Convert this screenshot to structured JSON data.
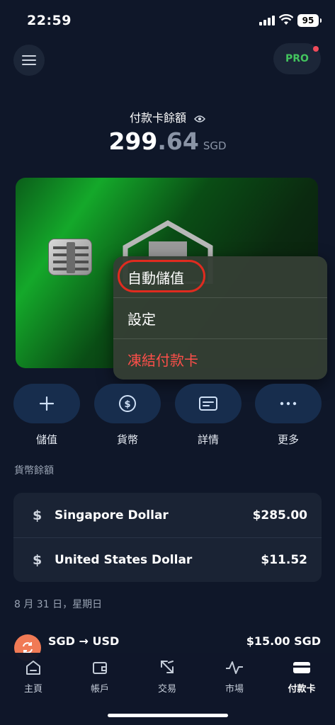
{
  "status_bar": {
    "time": "22:59",
    "battery": "95"
  },
  "header": {
    "pro_label": "PRO"
  },
  "balance": {
    "label": "付款卡餘額",
    "integer": "299",
    "decimal": ".64",
    "currency": "SGD"
  },
  "context_menu": {
    "items": [
      {
        "label": "自動儲值",
        "highlighted": true
      },
      {
        "label": "設定"
      },
      {
        "label": "凍結付款卡",
        "destructive": true
      }
    ]
  },
  "actions": [
    {
      "label": "儲值",
      "icon": "plus-icon"
    },
    {
      "label": "貨幣",
      "icon": "dollar-circle-icon"
    },
    {
      "label": "詳情",
      "icon": "card-details-icon"
    },
    {
      "label": "更多",
      "icon": "more-icon"
    }
  ],
  "currency_section": {
    "title": "貨幣餘額",
    "rows": [
      {
        "symbol": "$",
        "name": "Singapore Dollar",
        "amount": "$285.00"
      },
      {
        "symbol": "$",
        "name": "United States Dollar",
        "amount": "$11.52"
      }
    ]
  },
  "transactions": {
    "date": "8 月 31 日，星期日",
    "items": [
      {
        "pair": "SGD → USD",
        "amount": "$15.00 SGD",
        "icon": "exchange-icon"
      }
    ]
  },
  "tab_bar": {
    "tabs": [
      {
        "label": "主頁",
        "icon": "home-icon"
      },
      {
        "label": "帳戶",
        "icon": "wallet-icon"
      },
      {
        "label": "交易",
        "icon": "transfer-arrows-icon"
      },
      {
        "label": "市場",
        "icon": "chart-line-icon"
      },
      {
        "label": "付款卡",
        "icon": "card-icon",
        "active": true
      }
    ]
  },
  "colors": {
    "background": "#0f1729",
    "accent_green": "#43c45e",
    "destructive_red": "#ff4f4a",
    "highlight_ring": "#e02b1f"
  }
}
